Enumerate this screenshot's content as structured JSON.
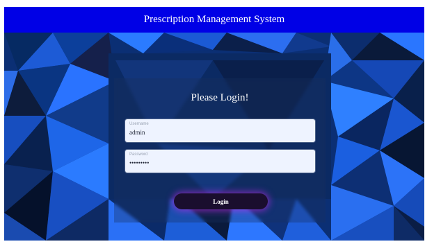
{
  "header": {
    "title": "Prescription Management System"
  },
  "login": {
    "title": "Please Login!",
    "username": {
      "label": "Username",
      "value": "admin"
    },
    "password": {
      "label": "Password",
      "value": "•••••••••"
    },
    "button_label": "Login"
  },
  "colors": {
    "header_bg": "#0000e6",
    "button_glow": "#dc28ff",
    "field_bg": "#eef3ff"
  }
}
